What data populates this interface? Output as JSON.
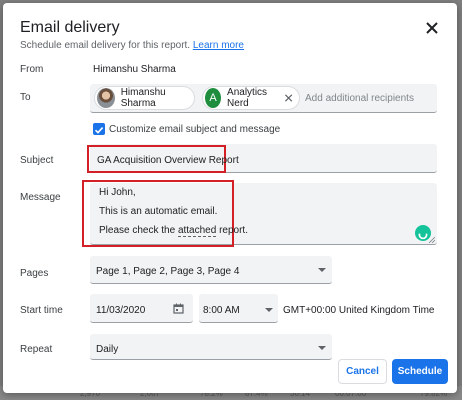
{
  "dialog": {
    "title": "Email delivery",
    "subtitle": "Schedule email delivery for this report.",
    "learn_more": "Learn more"
  },
  "icons": {
    "close": "close-icon",
    "check": "check-icon",
    "calendar": "calendar-icon",
    "dropdown": "chevron-down-icon",
    "chip_remove": "close-icon",
    "grammarly": "grammarly-icon"
  },
  "from": {
    "label": "From",
    "value": "Himanshu Sharma"
  },
  "to": {
    "label": "To",
    "chips": [
      {
        "name": "Himanshu Sharma",
        "avatar": "photo"
      },
      {
        "name": "Analytics Nerd",
        "avatar": "A"
      }
    ],
    "placeholder": "Add additional recipients"
  },
  "customize": {
    "label": "Customize email subject and message",
    "checked": true
  },
  "subject": {
    "label": "Subject",
    "value": "GA Acquisition Overview Report"
  },
  "message": {
    "label": "Message",
    "lines": [
      "Hi John,",
      "This is an automatic email.",
      "Please check the "
    ],
    "line3_link": "attached",
    "line3_end": " report."
  },
  "pages": {
    "label": "Pages",
    "value": "Page 1, Page 2, Page 3, Page 4"
  },
  "start_time": {
    "label": "Start time",
    "date": "11/03/2020",
    "time": "8:00 AM",
    "timezone": "GMT+00:00 United Kingdom Time"
  },
  "repeat": {
    "label": "Repeat",
    "value": "Daily"
  },
  "buttons": {
    "cancel": "Cancel",
    "schedule": "Schedule"
  },
  "background": {
    "values": [
      "2,970",
      "2,667",
      "78.2%",
      "87.4%",
      "30.14",
      "00.07.00",
      "79.82%"
    ]
  },
  "colors": {
    "accent": "#1a73e8",
    "highlight": "#d32027",
    "field_bg": "#f1f3f4",
    "grammarly": "#15c39a",
    "avatar_a": "#1e8e3e"
  }
}
